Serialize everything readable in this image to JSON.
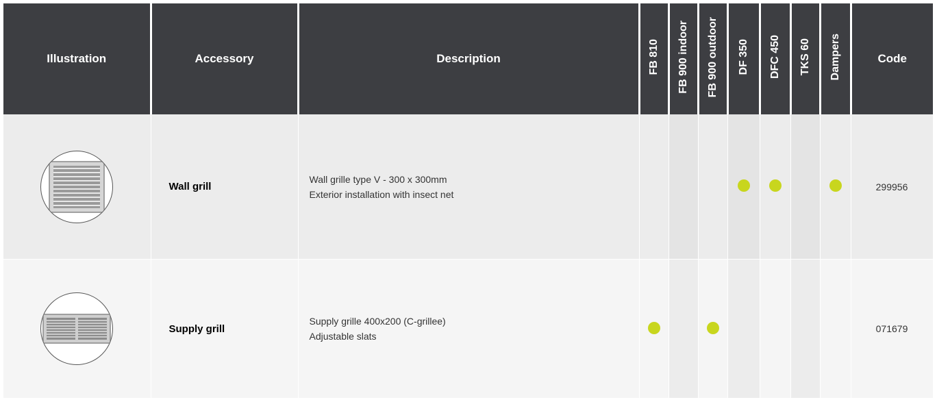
{
  "headers": {
    "illustration": "Illustration",
    "accessory": "Accessory",
    "description": "Description",
    "fb810": "FB 810",
    "fb900_indoor": "FB 900 indoor",
    "fb900_outdoor": "FB 900 outdoor",
    "df350": "DF 350",
    "dfc450": "DFC 450",
    "tks60": "TKS 60",
    "dampers": "Dampers",
    "code": "Code"
  },
  "rows": [
    {
      "image": "wall-grille-image",
      "accessory": "Wall grill",
      "description_line1": "Wall grille type V - 300 x 300mm",
      "description_line2": "Exterior installation with insect net",
      "compat": {
        "fb810": false,
        "fb900_indoor": false,
        "fb900_outdoor": false,
        "df350": true,
        "dfc450": true,
        "tks60": false,
        "dampers": true
      },
      "code": "299956"
    },
    {
      "image": "supply-grille-image",
      "accessory": "Supply grill",
      "description_line1": "Supply grille 400x200 (C-grillee)",
      "description_line2": "Adjustable slats",
      "compat": {
        "fb810": true,
        "fb900_indoor": false,
        "fb900_outdoor": true,
        "df350": false,
        "dfc450": false,
        "tks60": false,
        "dampers": false
      },
      "code": "071679"
    }
  ],
  "colors": {
    "header_bg": "#3d3e42",
    "dot": "#c8d61e"
  }
}
